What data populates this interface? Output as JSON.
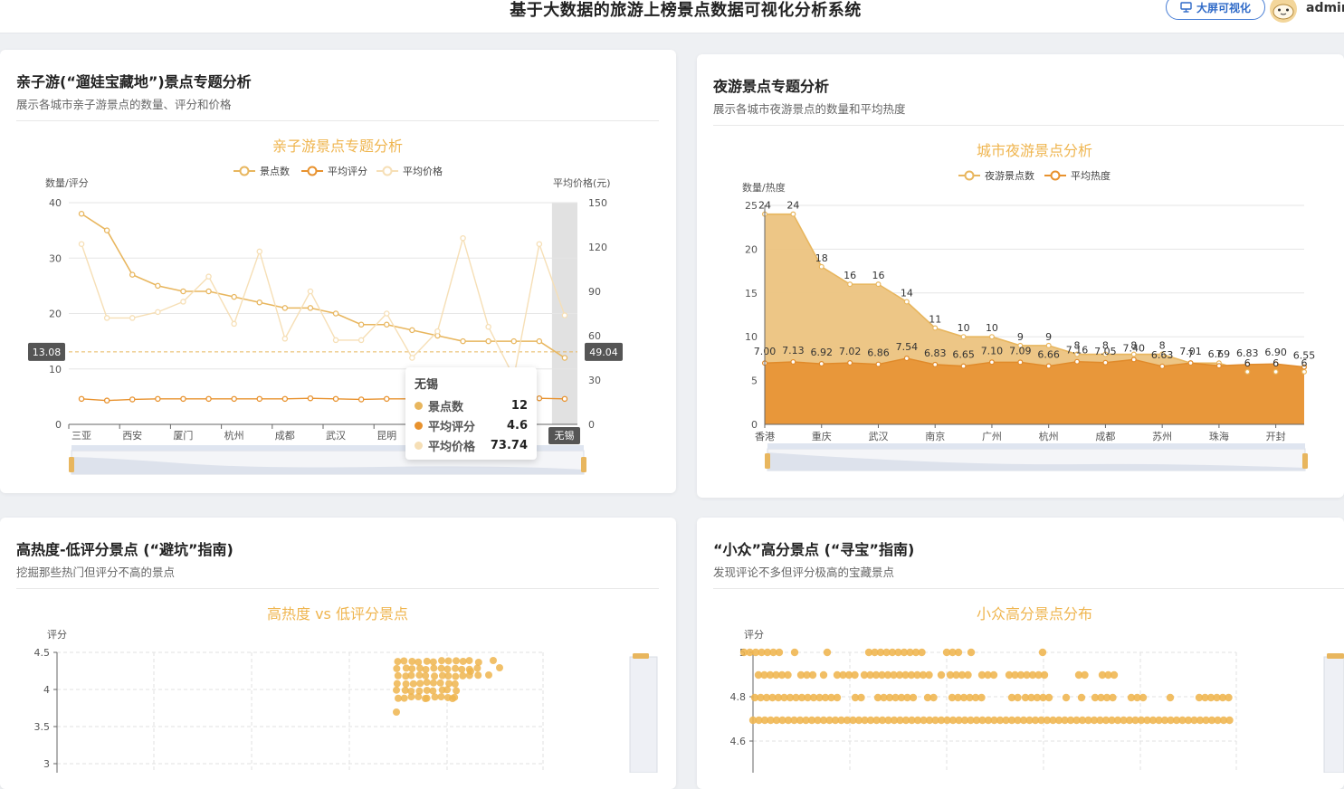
{
  "header": {
    "title": "基于大数据的旅游上榜景点数据可视化分析系统",
    "bigscreen_label": "大屏可视化",
    "user": "admin"
  },
  "colors": {
    "accent": "#e8b65e",
    "dark_orange": "#e8922e",
    "light": "#f6dfb6",
    "title_orange": "#efb54f"
  },
  "cards": {
    "family": {
      "title": "亲子游(“遛娃宝藏地”)景点专题分析",
      "subtitle": "展示各城市亲子游景点的数量、评分和价格"
    },
    "night": {
      "title": "夜游景点专题分析",
      "subtitle": "展示各城市夜游景点的数量和平均热度"
    },
    "hot_low": {
      "title": "高热度-低评分景点 (“避坑”指南)",
      "subtitle": "挖掘那些热门但评分不高的景点"
    },
    "niche": {
      "title": "“小众”高分景点 (“寻宝”指南)",
      "subtitle": "发现评论不多但评分极高的宝藏景点"
    }
  },
  "tooltip": {
    "title": "无锡",
    "rows": [
      {
        "label": "景点数",
        "value": "12"
      },
      {
        "label": "平均评分",
        "value": "4.6"
      },
      {
        "label": "平均价格",
        "value": "73.74"
      }
    ]
  },
  "chart_data": [
    {
      "type": "line",
      "title": "亲子游景点专题分析",
      "legend": [
        "景点数",
        "平均评分",
        "平均价格"
      ],
      "ylabel": "数量/评分",
      "y2label": "平均价格(元)",
      "ylim": [
        0,
        40
      ],
      "y2lim": [
        0,
        150
      ],
      "yticks": [
        0,
        10,
        20,
        30,
        40
      ],
      "y2ticks": [
        0,
        30,
        60,
        90,
        120,
        150
      ],
      "x_tick_labels": [
        "三亚",
        "西安",
        "厦门",
        "杭州",
        "成都",
        "武汉",
        "昆明",
        "",
        "",
        "无锡"
      ],
      "highlight": "无锡",
      "pointer_left": "13.08",
      "pointer_right": "49.04",
      "series": [
        {
          "name": "景点数",
          "axis": "left",
          "values": [
            38,
            35,
            27,
            25,
            24,
            24,
            23,
            22,
            21,
            21,
            20,
            18,
            18,
            17,
            16,
            15,
            15,
            15,
            15,
            12
          ]
        },
        {
          "name": "平均评分",
          "axis": "left",
          "values": [
            4.6,
            4.3,
            4.5,
            4.6,
            4.6,
            4.6,
            4.6,
            4.6,
            4.6,
            4.7,
            4.6,
            4.5,
            4.6,
            4.6,
            4.6,
            4.6,
            4.6,
            4.6,
            4.7,
            4.6
          ]
        },
        {
          "name": "平均价格",
          "axis": "right",
          "values": [
            122,
            72,
            72,
            76,
            83,
            100,
            68,
            117,
            58,
            90,
            57,
            57,
            75,
            45,
            63,
            126,
            66,
            32,
            122,
            73.74
          ]
        }
      ]
    },
    {
      "type": "area",
      "title": "城市夜游景点分析",
      "legend": [
        "夜游景点数",
        "平均热度"
      ],
      "ylabel": "数量/热度",
      "ylim": [
        0,
        25
      ],
      "yticks": [
        0,
        5,
        10,
        15,
        20,
        25
      ],
      "x_tick_labels": [
        "香港",
        "重庆",
        "武汉",
        "南京",
        "广州",
        "杭州",
        "成都",
        "苏州",
        "珠海",
        "开封"
      ],
      "series": [
        {
          "name": "夜游景点数",
          "values": [
            24,
            24,
            18,
            16,
            16,
            14,
            11,
            10,
            10,
            9,
            9,
            8,
            8,
            8,
            8,
            7,
            7,
            6,
            6,
            6
          ]
        },
        {
          "name": "平均热度",
          "values": [
            7.0,
            7.13,
            6.92,
            7.02,
            6.86,
            7.54,
            6.83,
            6.65,
            7.1,
            7.09,
            6.66,
            7.16,
            7.05,
            7.4,
            6.63,
            7.01,
            6.69,
            6.83,
            6.9,
            6.55
          ]
        }
      ]
    },
    {
      "type": "scatter",
      "title": "高热度 vs 低评分景点",
      "ylabel": "评分",
      "yticks": [
        3,
        3.5,
        4,
        4.5
      ],
      "ylim": [
        2.9,
        4.5
      ]
    },
    {
      "type": "scatter",
      "title": "小众高分景点分布",
      "ylabel": "评分",
      "yticks": [
        4.6,
        4.8,
        5
      ],
      "ylim": [
        4.55,
        5
      ]
    }
  ]
}
